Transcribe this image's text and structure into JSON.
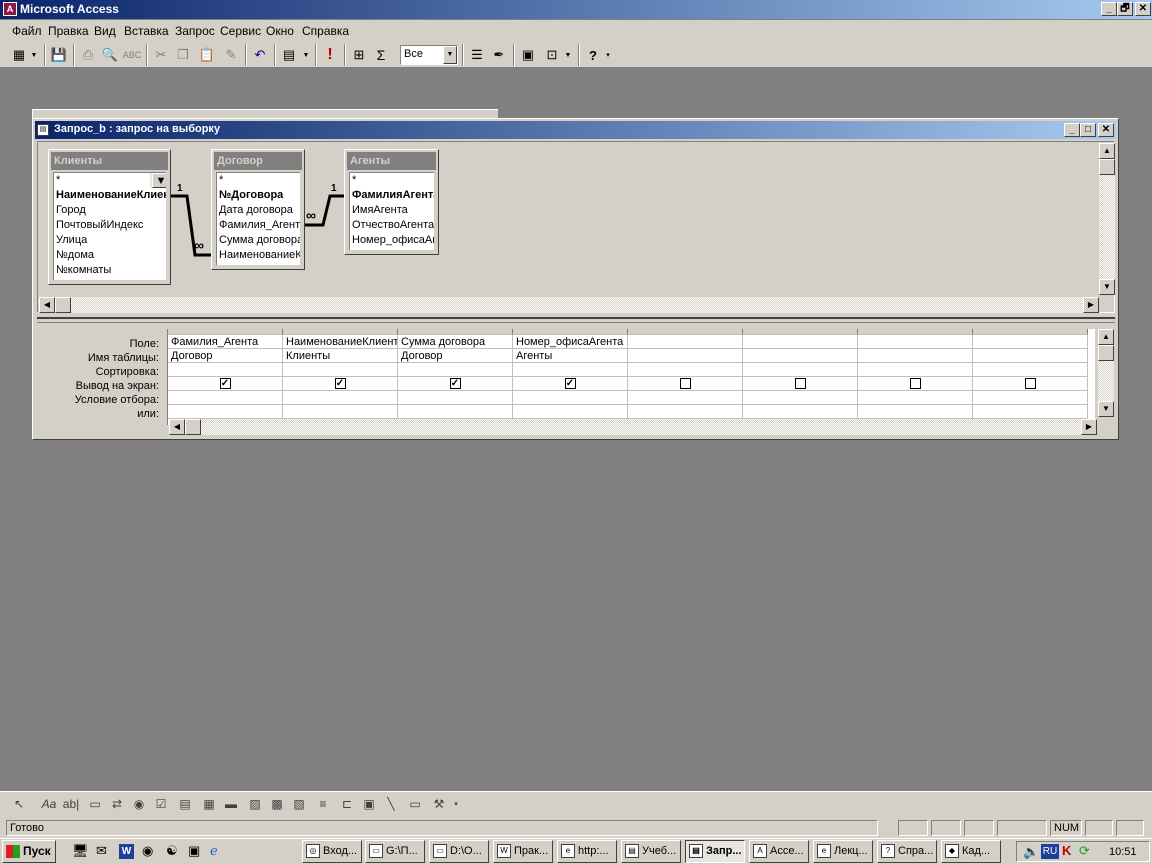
{
  "app": {
    "title": "Microsoft Access",
    "window_controls": [
      "_",
      "🗗",
      "✕"
    ]
  },
  "menu": [
    "Файл",
    "Правка",
    "Вид",
    "Вставка",
    "Запрос",
    "Сервис",
    "Окно",
    "Справка"
  ],
  "toolbar": {
    "view_label": "▦",
    "top_values": "Все",
    "top_values_arrow": "▼"
  },
  "query_window": {
    "title": "Запрос_b : запрос на выборку",
    "tables": [
      {
        "name": "Клиенты",
        "fields": [
          "*",
          "НаименованиеКлиента",
          "Город",
          "ПочтовыйИндекс",
          "Улица",
          "№дома",
          "№комнаты"
        ],
        "bold": [
          1
        ]
      },
      {
        "name": "Договор",
        "fields": [
          "*",
          "№Договора",
          "Дата договора",
          "Фамилия_Агента",
          "Сумма договора",
          "НаименованиеКлиента"
        ],
        "bold": [
          1
        ]
      },
      {
        "name": "Агенты",
        "fields": [
          "*",
          "ФамилияАгента",
          "ИмяАгента",
          "ОтчествоАгента",
          "Номер_офисаАгента"
        ],
        "bold": [
          1
        ]
      }
    ],
    "relations": [
      {
        "one": "1",
        "many": "∞"
      },
      {
        "one": "1",
        "many": "∞"
      }
    ],
    "grid": {
      "row_labels": [
        "Поле:",
        "Имя таблицы:",
        "Сортировка:",
        "Вывод на экран:",
        "Условие отбора:",
        "или:"
      ],
      "columns": [
        {
          "field": "Фамилия_Агента",
          "table": "Договор",
          "show": true
        },
        {
          "field": "НаименованиеКлиента",
          "table": "Клиенты",
          "show": true
        },
        {
          "field": "Сумма договора",
          "table": "Договор",
          "show": true
        },
        {
          "field": "Номер_офисаАгента",
          "table": "Агенты",
          "show": true
        },
        {
          "field": "",
          "table": "",
          "show": false
        },
        {
          "field": "",
          "table": "",
          "show": false
        },
        {
          "field": "",
          "table": "",
          "show": false
        },
        {
          "field": "",
          "table": "",
          "show": false
        }
      ]
    }
  },
  "status": {
    "text": "Готово",
    "num": "NUM"
  },
  "taskbar": {
    "start": "Пуск",
    "tasks": [
      "Вход...",
      "G:\\П...",
      "D:\\О...",
      "Прак...",
      "http:...",
      "Учеб...",
      "Запр...",
      "Acce...",
      "Лекц...",
      "Спра...",
      "Кад..."
    ],
    "lang": "RU",
    "clock": "10:51"
  }
}
